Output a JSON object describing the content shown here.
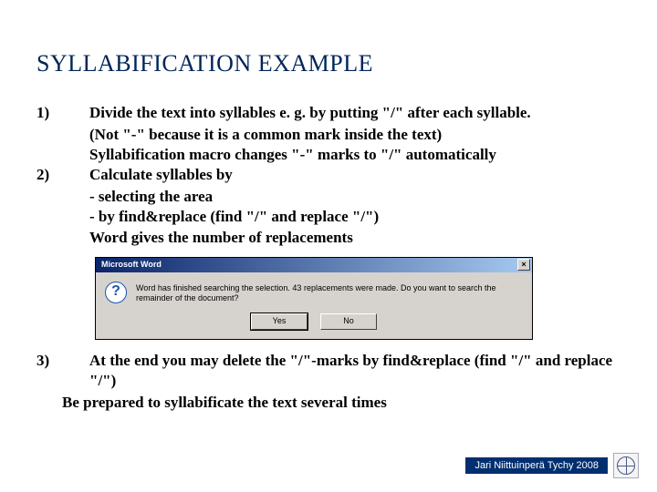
{
  "title": "SYLLABIFICATION EXAMPLE",
  "items": {
    "n1": "1)",
    "t1a": "Divide the text into syllables e. g. by putting \"/\" after each syllable.",
    "t1b": "(Not \"-\" because it is a common mark inside the text)",
    "t1c": "Syllabification macro changes \"-\" marks to \"/\" automatically",
    "n2": "2)",
    "t2a": "Calculate syllables by",
    "t2b": "- selecting the area",
    "t2c": "- by find&replace (find \"/\" and replace \"/\")",
    "t2d": "Word gives the number of replacements",
    "n3": "3)",
    "t3a": "At the end you may delete the \"/\"-marks by find&replace (find \"/\" and replace \"/\")",
    "t3b": "Be prepared to syllabificate the text several times"
  },
  "dialog": {
    "title": "Microsoft Word",
    "close": "×",
    "icon": "?",
    "message": "Word has finished searching the selection. 43 replacements were made. Do you want to search the remainder of the document?",
    "yes": "Yes",
    "no": "No"
  },
  "footer": {
    "text": "Jari Niittuinperä Tychy 2008"
  }
}
